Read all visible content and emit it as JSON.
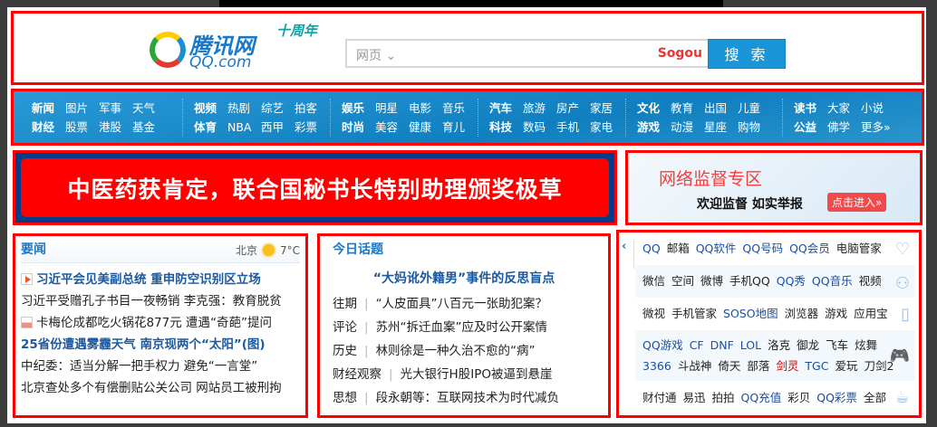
{
  "header": {
    "logo_cn": "腾讯网",
    "logo_en": "QQ.com",
    "logo_badge": "十周年",
    "search_category": "网页",
    "search_engine": "Sogou",
    "search_button": "搜 索"
  },
  "nav": {
    "groups": [
      [
        [
          "新闻",
          "图片",
          "军事",
          "天气"
        ],
        [
          "财经",
          "股票",
          "港股",
          "基金"
        ]
      ],
      [
        [
          "视频",
          "热剧",
          "综艺",
          "拍客"
        ],
        [
          "体育",
          "NBA",
          "西甲",
          "彩票"
        ]
      ],
      [
        [
          "娱乐",
          "明星",
          "电影",
          "音乐"
        ],
        [
          "时尚",
          "美容",
          "健康",
          "育儿"
        ]
      ],
      [
        [
          "汽车",
          "旅游",
          "房产",
          "家居"
        ],
        [
          "科技",
          "数码",
          "手机",
          "家电"
        ]
      ],
      [
        [
          "文化",
          "教育",
          "出国",
          "儿童"
        ],
        [
          "游戏",
          "动漫",
          "星座",
          "购物"
        ]
      ],
      [
        [
          "读书",
          "大家",
          "小说"
        ],
        [
          "公益",
          "佛学",
          "更多»"
        ]
      ]
    ]
  },
  "banner": {
    "headline": "中医药获肯定，联合国秘书长特别助理颁奖极草"
  },
  "ad": {
    "title": "网络监督专区",
    "slogan": "欢迎监督  如实举报",
    "cta": "点击进入»"
  },
  "news": {
    "title": "要闻",
    "city": "北京",
    "temp": "7°C",
    "items": [
      {
        "text": "习近平会见美副总统  重申防空识别区立场",
        "hl": true,
        "icon": "play"
      },
      {
        "text": "习近平受赠孔子书目一夜畅销  李克强：教育脱贫",
        "hl": false,
        "icon": ""
      },
      {
        "text": "卡梅伦成都吃火锅花877元  遭遇“奇葩”提问",
        "hl": false,
        "icon": "pic"
      },
      {
        "text": "25省份遭遇雾霾天气  南京现两个“太阳”(图)",
        "hl": true,
        "icon": ""
      },
      {
        "text": "中纪委：适当分解一把手权力  避免“一言堂”",
        "hl": false,
        "icon": ""
      },
      {
        "text": "北京查处多个有偿删贴公关公司  网站员工被刑拘",
        "hl": false,
        "icon": ""
      }
    ]
  },
  "topic": {
    "title": "今日话题",
    "featured": "“大妈讹外籍男”事件的反思盲点",
    "items": [
      {
        "cat": "往期",
        "text": "“人皮面具”八百元一张助犯案？"
      },
      {
        "cat": "评论",
        "text": "苏州“拆迁血案”应及时公开案情"
      },
      {
        "cat": "历史",
        "text": "林则徐是一种久治不愈的“病”"
      },
      {
        "cat": "财经观察",
        "text": "光大银行H股IPO被逼到悬崖"
      },
      {
        "cat": "思想",
        "text": "段永朝等：互联网技术为时代减负"
      }
    ]
  },
  "services": {
    "rows": [
      [
        "QQ",
        "邮箱",
        "QQ软件",
        "QQ号码",
        "QQ会员",
        "电脑管家"
      ],
      [
        "微信",
        "空间",
        "微博",
        "手机QQ",
        "QQ秀",
        "QQ音乐",
        "视频"
      ],
      [
        "微视",
        "手机管家",
        "SOSO地图",
        "浏览器",
        "游戏",
        "应用宝"
      ],
      [
        "QQ游戏",
        "CF",
        "DNF",
        "LOL",
        "洛克",
        "御龙",
        "飞车",
        "炫舞"
      ],
      [
        "3366",
        "斗战神",
        "倚天",
        "部落",
        "剑灵",
        "TGC",
        "爱玩",
        "刀剑2"
      ],
      [
        "财付通",
        "易迅",
        "拍拍",
        "QQ充值",
        "彩贝",
        "QQ彩票",
        "全部"
      ]
    ]
  }
}
